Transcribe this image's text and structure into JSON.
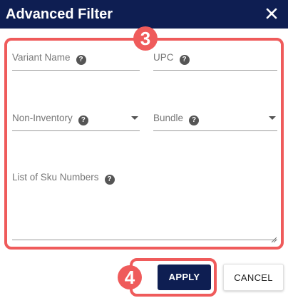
{
  "dialog": {
    "title": "Advanced Filter",
    "close_icon": "close-icon"
  },
  "annotations": {
    "fields_badge": "3",
    "apply_badge": "4",
    "color": "#ef5b5b"
  },
  "fields": {
    "variant_name": {
      "label": "Variant Name",
      "help_icon": "help-circle-icon"
    },
    "upc": {
      "label": "UPC",
      "help_icon": "help-circle-icon"
    },
    "non_inventory": {
      "label": "Non-Inventory",
      "help_icon": "help-circle-icon",
      "dropdown_icon": "caret-down-icon"
    },
    "bundle": {
      "label": "Bundle",
      "help_icon": "help-circle-icon",
      "dropdown_icon": "caret-down-icon"
    },
    "sku_numbers": {
      "label": "List of Sku Numbers",
      "help_icon": "help-circle-icon"
    }
  },
  "actions": {
    "apply_label": "APPLY",
    "cancel_label": "CANCEL"
  },
  "colors": {
    "header": "#0e1e52",
    "apply_button": "#0e1e52"
  }
}
